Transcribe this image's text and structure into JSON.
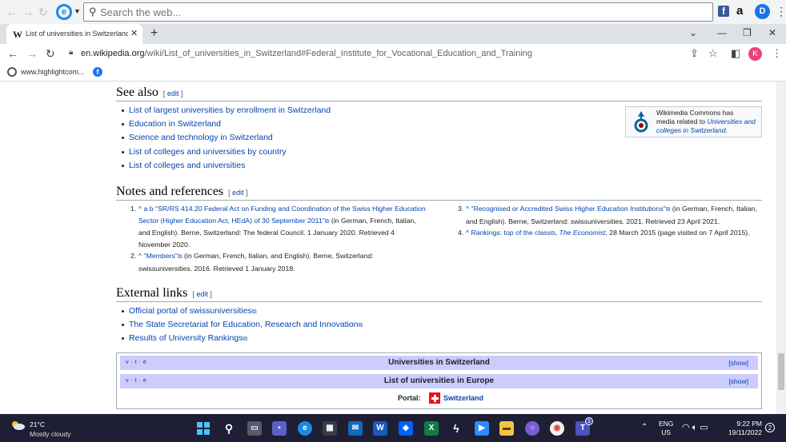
{
  "top_bar": {
    "search_placeholder": "Search the web...",
    "extensions": [
      "facebook-icon",
      "amazon-icon",
      "d-extension-icon"
    ],
    "amazon_label": "a",
    "d_label": "D"
  },
  "tab": {
    "title": "List of universities in Switzerland",
    "favicon": "W"
  },
  "address_bar": {
    "host": "en.wikipedia.org",
    "path": "/wiki/List_of_universities_in_Switzerland#Federal_Institute_for_Vocational_Education_and_Training",
    "profile_initial": "K"
  },
  "bookmarks": {
    "item1": "www.highlightcom..."
  },
  "see_also": {
    "heading": "See also",
    "edit": "edit",
    "items": [
      "List of largest universities by enrollment in Switzerland",
      "Education in Switzerland",
      "Science and technology in Switzerland",
      "List of colleges and universities by country",
      "List of colleges and universities"
    ]
  },
  "commons": {
    "line1": "Wikimedia Commons has",
    "line2": "media related to ",
    "link": "Universities and colleges in Switzerland",
    "tail": "."
  },
  "notes": {
    "heading": "Notes and references",
    "edit": "edit",
    "ref1": {
      "num": "1.",
      "marks": "^ a b",
      "link": "\"SR/RS 414.20 Federal Act on Funding and Coordination of the Swiss Higher Education Sector (Higher Education Act, HEdA) of 30 September 2011\"",
      "rest": " (in German, French, Italian, and English). Berne, Switzerland: The federal Council. 1 January 2020. Retrieved 4 November 2020."
    },
    "ref2": {
      "num": "2.",
      "marks": "^",
      "link": "\"Members\"",
      "rest": " (in German, French, Italian, and English). Berne, Switzerland: swissuniversities. 2016. Retrieved 1 January 2018."
    },
    "ref3": {
      "num": "3.",
      "marks": "^",
      "link": "\"Recognised or Accredited Swiss Higher Education Institutions\"",
      "rest": " (in German, French, Italian, and English). Berne, Switzerland: swissuniversities. 2021. Retrieved 23 April 2021."
    },
    "ref4": {
      "num": "4.",
      "marks": "^",
      "link": "Rankings: top of the class",
      "pub": "The Economist",
      "rest": ", 28 March 2015 (page visited on 7 April 2015)."
    }
  },
  "external_links": {
    "heading": "External links",
    "edit": "edit",
    "items": [
      "Official portal of swissuniversities",
      "The State Secretariat for Education, Research and Innovation",
      "Results of University Rankings"
    ]
  },
  "navboxes": {
    "vte": "v · t · e",
    "box1_title": "Universities in Switzerland",
    "box2_title": "List of universities in Europe",
    "show": "[show]",
    "portal_label": "Portal:",
    "portal_link": "Switzerland"
  },
  "taskbar": {
    "temperature": "21°C",
    "weather": "Mostly cloudy",
    "lang1": "ENG",
    "lang2": "US",
    "time": "9:22 PM",
    "date": "19/11/2022",
    "teams_badge": "1",
    "notifications": "2"
  },
  "colors": {
    "link": "#0645ad",
    "navbox_header": "#ccccff",
    "taskbar": "#1e1f35"
  }
}
